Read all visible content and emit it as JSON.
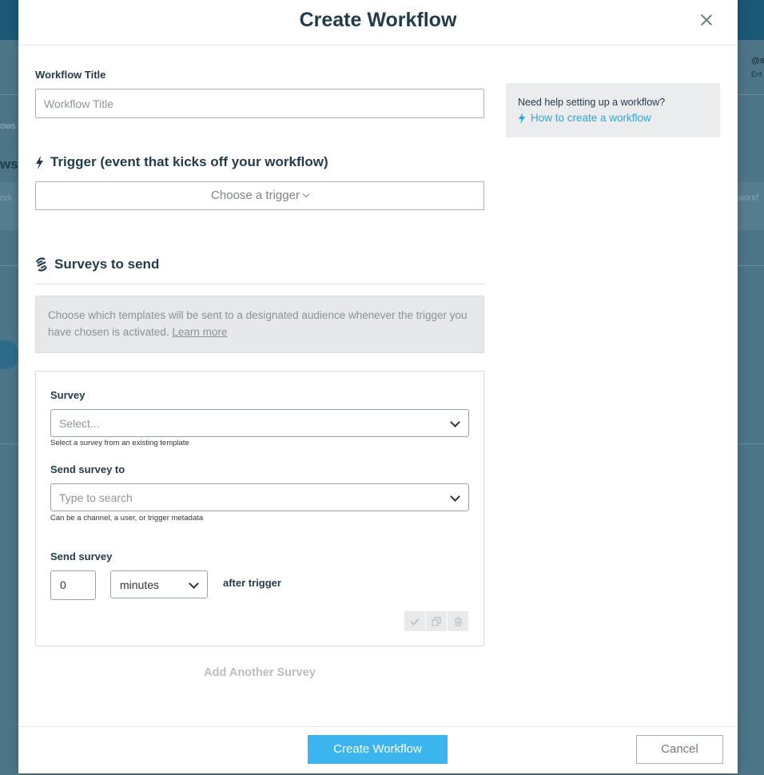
{
  "modal": {
    "title": "Create Workflow",
    "close_label": "×"
  },
  "workflow_title": {
    "label": "Workflow Title",
    "placeholder": "Workflow Title"
  },
  "trigger": {
    "heading": "Trigger (event that kicks off your workflow)",
    "button_label": "Choose a trigger"
  },
  "surveys": {
    "heading": "Surveys to send",
    "info_text": "Choose which templates will be sent to a designated audience whenever the trigger you have chosen is activated.",
    "learn_more": "Learn more",
    "card": {
      "survey_label": "Survey",
      "survey_placeholder": "Select...",
      "survey_hint": "Select a survey from an existing template",
      "send_to_label": "Send survey to",
      "send_to_placeholder": "Type to search",
      "send_to_hint": "Can be a channel, a user, or trigger metadata",
      "send_label": "Send survey",
      "delay_value": "0",
      "delay_unit": "minutes",
      "after_trigger": "after trigger"
    },
    "add_another": "Add Another Survey"
  },
  "help": {
    "question": "Need help setting up a workflow?",
    "link": "How to create a workflow"
  },
  "footer": {
    "create_button": "Create Workflow",
    "cancel_button": "Cancel"
  },
  "background": {
    "left_text_1": "ows",
    "left_text_2": "ws",
    "left_text_3": "ork",
    "right_text_1": "@s",
    "right_text_2": "Ent",
    "right_text_3": "workf"
  },
  "colors": {
    "accent": "#3cb5ef",
    "link": "#29a8e0",
    "heading": "#1f3b4d",
    "backdrop": "#4d7588"
  }
}
